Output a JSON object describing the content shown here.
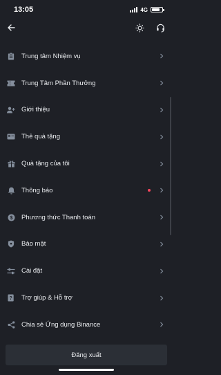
{
  "status_bar": {
    "time": "13:05",
    "network": "4G",
    "battery_level": 0.75
  },
  "nav": {
    "back_icon": "back-arrow-icon",
    "theme_icon": "sun-icon",
    "support_icon": "headset-icon"
  },
  "menu": {
    "items": [
      {
        "label": "Trung tâm Nhiệm vụ",
        "icon": "clipboard-icon",
        "badge": false
      },
      {
        "label": "Trung Tâm Phần Thưởng",
        "icon": "ticket-icon",
        "badge": false
      },
      {
        "label": "Giới thiệu",
        "icon": "add-user-icon",
        "badge": false
      },
      {
        "label": "Thẻ quà tặng",
        "icon": "card-icon",
        "badge": false
      },
      {
        "label": "Quà tặng của tôi",
        "icon": "gift-icon",
        "badge": false
      },
      {
        "label": "Thông báo",
        "icon": "bell-icon",
        "badge": true
      },
      {
        "label": "Phương thức Thanh toán",
        "icon": "dollar-icon",
        "badge": false
      },
      {
        "label": "Bảo mật",
        "icon": "shield-icon",
        "badge": false
      },
      {
        "label": "Cài đặt",
        "icon": "sliders-icon",
        "badge": false
      },
      {
        "label": "Trợ giúp & Hỗ trợ",
        "icon": "help-doc-icon",
        "badge": false
      },
      {
        "label": "Chia sẻ Ứng dụng Binance",
        "icon": "share-icon",
        "badge": false
      }
    ]
  },
  "logout": {
    "label": "Đăng xuất"
  },
  "colors": {
    "background": "#1e2026",
    "button": "#2b2f36",
    "text": "#eaecef",
    "icon": "#848e9c",
    "badge": "#f6465d"
  }
}
